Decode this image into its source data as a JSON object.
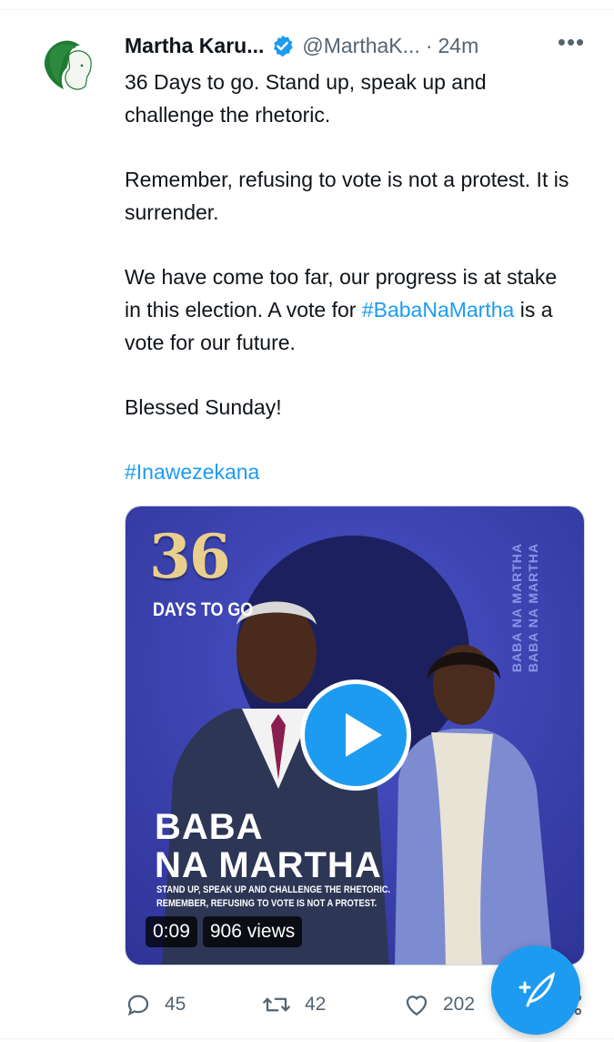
{
  "tweet": {
    "author_name": "Martha Karu...",
    "handle": "@MarthaK...",
    "separator": "·",
    "time": "24m",
    "more_label": "•••",
    "lines": {
      "p1": "36 Days to go. Stand up, speak up and challenge the rhetoric.",
      "p2": "Remember, refusing to vote is not a protest. It is surrender.",
      "p3_a": "We have come too far, our progress is at stake in this election. A vote for ",
      "p3_hashtag": "#BabaNaMartha",
      "p3_b": " is a vote for our future.",
      "p4": "Blessed Sunday!",
      "p5_hashtag": "#Inawezekana"
    }
  },
  "media": {
    "big_number": "36",
    "days_to_go": "DAYS TO GO",
    "vertical_text": "BABA NA MARTHA",
    "headline_1": "BABA",
    "headline_2": "NA MARTHA",
    "slogan_1": "STAND UP, SPEAK UP AND CHALLENGE THE RHETORIC.",
    "slogan_2": "REMEMBER, REFUSING TO VOTE IS NOT A PROTEST.",
    "duration": "0:09",
    "views": "906 views"
  },
  "actions": {
    "replies": "45",
    "retweets": "42",
    "likes": "202"
  },
  "colors": {
    "accent": "#1d9bf0",
    "text": "#0f1419",
    "muted": "#536471",
    "poster_blue": "#3f44b6"
  },
  "icons": [
    "verified-badge-icon",
    "more-options-icon",
    "play-icon",
    "reply-icon",
    "retweet-icon",
    "like-icon",
    "share-icon",
    "compose-tweet-icon"
  ]
}
